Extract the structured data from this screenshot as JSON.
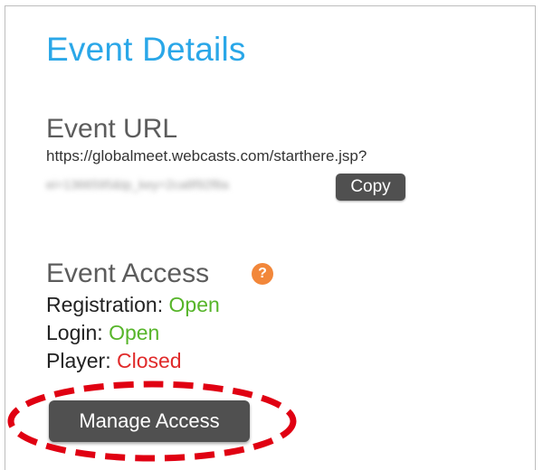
{
  "header": {
    "title": "Event Details"
  },
  "event_url": {
    "heading": "Event URL",
    "url_line1": "https://globalmeet.webcasts.com/starthere.jsp?",
    "url_line2_blurred": "ei=1366595&tp_key=2ca8f92f8a",
    "copy_label": "Copy"
  },
  "event_access": {
    "heading": "Event Access",
    "help_glyph": "?",
    "items": [
      {
        "label": "Registration:",
        "value": "Open",
        "status_color": "#57b52a"
      },
      {
        "label": "Login:",
        "value": "Open",
        "status_color": "#57b52a"
      },
      {
        "label": "Player:",
        "value": "Closed",
        "status_color": "#e02a2a"
      }
    ],
    "manage_label": "Manage Access"
  },
  "colors": {
    "accent": "#2aa7e8",
    "button_bg": "#505050",
    "help_icon": "#f2873a",
    "annotation": "#e00012"
  }
}
